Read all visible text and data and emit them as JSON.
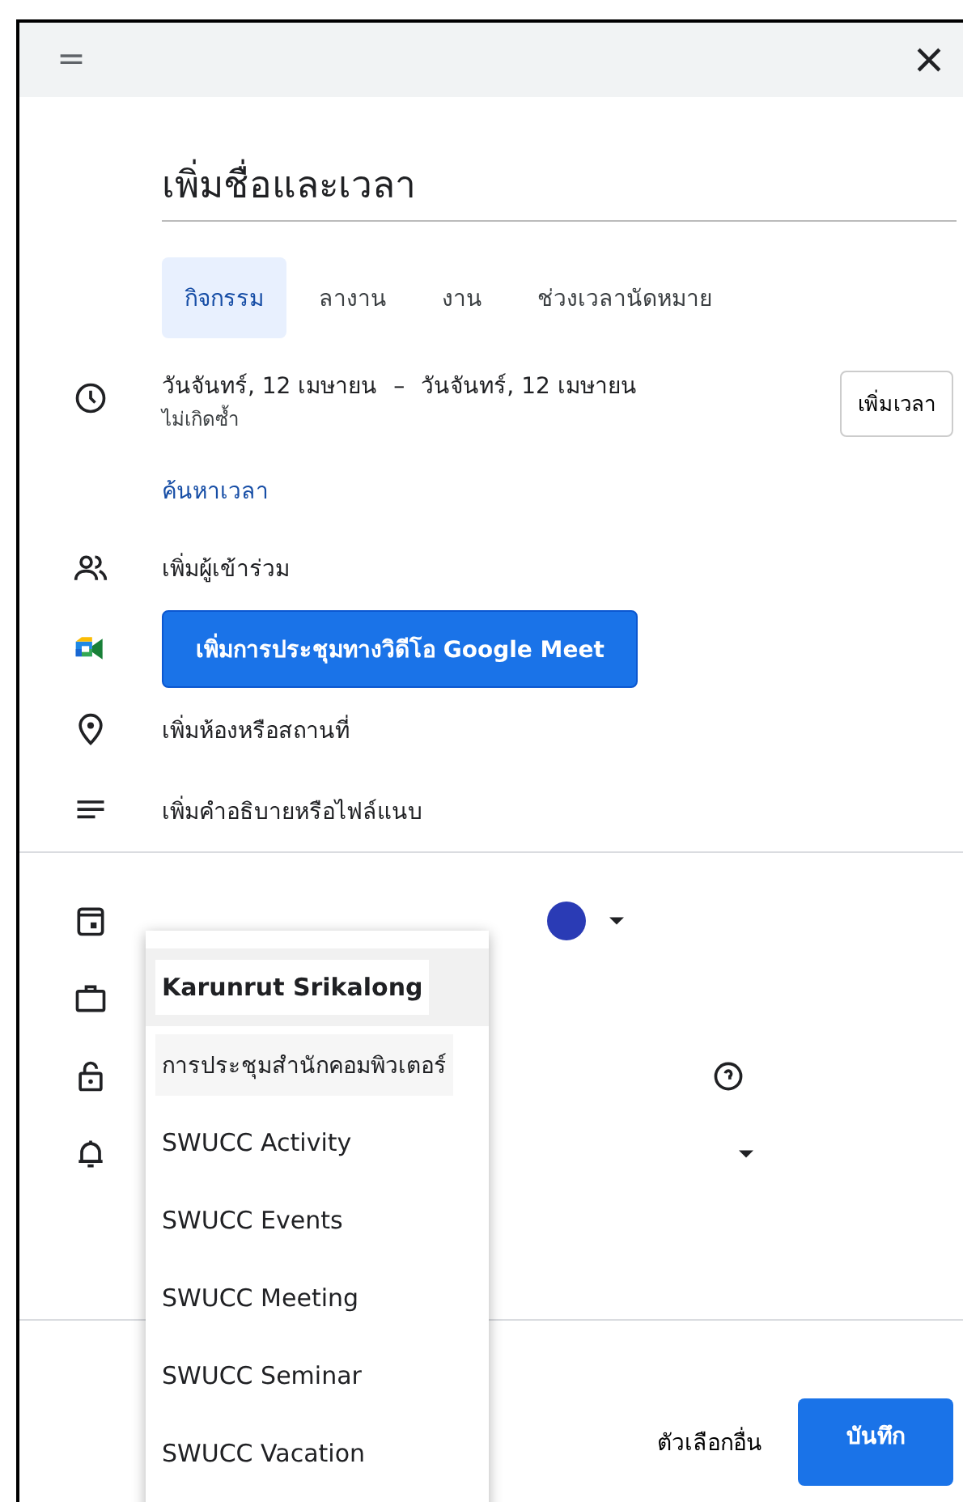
{
  "title_field": {
    "placeholder": "เพิ่มชื่อและเวลา"
  },
  "tabs": [
    {
      "label": "กิจกรรม",
      "selected": true
    },
    {
      "label": "ลางาน",
      "selected": false
    },
    {
      "label": "งาน",
      "selected": false
    },
    {
      "label": "ช่วงเวลานัดหมาย",
      "selected": false
    }
  ],
  "date": {
    "start": "วันจันทร์, 12 เมษายน",
    "separator": "–",
    "end": "วันจันทร์, 12 เมษายน",
    "repeat": "ไม่เกิดซ้ำ",
    "add_time_button": "เพิ่มเวลา"
  },
  "find_time_link": "ค้นหาเวลา",
  "rows": [
    {
      "kind": "guests",
      "label": "เพิ่มผู้เข้าร่วม"
    },
    {
      "kind": "meet",
      "label": "เพิ่มการประชุมทางวิดีโอ Google Meet"
    },
    {
      "kind": "location",
      "label": "เพิ่มห้องหรือสถานที่"
    },
    {
      "kind": "description",
      "label": "เพิ่มคำอธิบายหรือไฟล์แนบ"
    }
  ],
  "calendar_row": {
    "color": "#2a3bb5"
  },
  "calendar_menu": [
    {
      "label": "Karunrut Srikalong",
      "selected": true,
      "highlighted": false
    },
    {
      "label": "การประชุมสำนักคอมพิวเตอร์",
      "selected": false,
      "highlighted": true
    },
    {
      "label": "SWUCC Activity",
      "selected": false,
      "highlighted": false
    },
    {
      "label": "SWUCC Events",
      "selected": false,
      "highlighted": false
    },
    {
      "label": "SWUCC Meeting",
      "selected": false,
      "highlighted": false
    },
    {
      "label": "SWUCC Seminar",
      "selected": false,
      "highlighted": false
    },
    {
      "label": "SWUCC Vacation",
      "selected": false,
      "highlighted": false
    }
  ],
  "footer": {
    "more_options": "ตัวเลือกอื่น",
    "save": "บันทึก"
  }
}
